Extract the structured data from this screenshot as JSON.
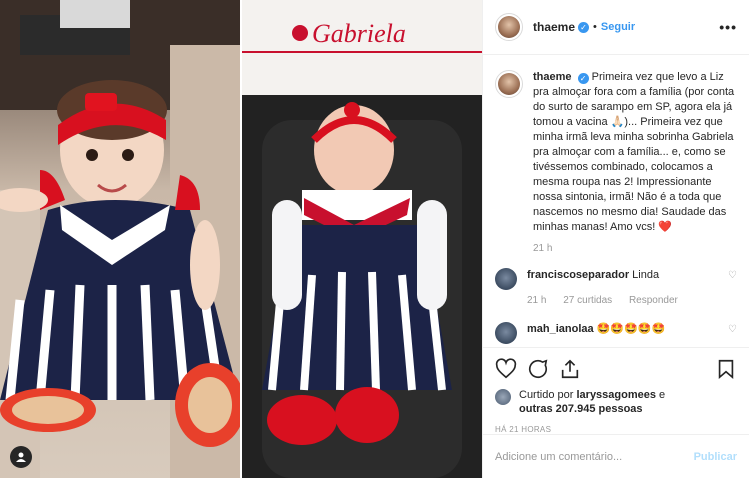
{
  "post": {
    "username": "thaeme",
    "follow_label": "Seguir",
    "more_label": "•••",
    "caption": "Primeira vez que levo a Liz pra almoçar fora com a família (por conta do surto de sarampo em SP, agora ela já tomou a vacina 🙏🏻)... Primeira vez que minha irmã leva minha sobrinha Gabriela pra almoçar com a família... e, como se tivéssemos combinado, colocamos a mesma roupa nas 2! Impressionante nossa sintonia, irmã! Não é a toda que nascemos no mesmo dia! Saudade das minhas manas! Amo vcs! ❤️",
    "caption_time": "21 h",
    "photo_embroidery": "Gabriela"
  },
  "comments": [
    {
      "username": "franciscoseparador",
      "text": "Linda",
      "time": "21 h",
      "likes": "27 curtidas",
      "reply": "Responder"
    },
    {
      "username": "mah_ianolaa",
      "text": "🤩🤩🤩🤩🤩",
      "time": "",
      "likes": "",
      "reply": ""
    }
  ],
  "likes_section": {
    "prefix": "Curtido por",
    "first_user": "laryssagomees",
    "connector": "e",
    "others": "outras 207.945 pessoas"
  },
  "time_ago": "HÁ 21 HORAS",
  "add_comment": {
    "placeholder": "Adicione um comentário...",
    "publish_label": "Publicar"
  },
  "colors": {
    "accent": "#3897f0",
    "publish_disabled": "#b2dffc",
    "muted": "#999999"
  },
  "icons": [
    "user-tag-icon",
    "verified-icon",
    "more-options-icon",
    "heart-icon",
    "comment-icon",
    "share-icon",
    "bookmark-icon"
  ]
}
